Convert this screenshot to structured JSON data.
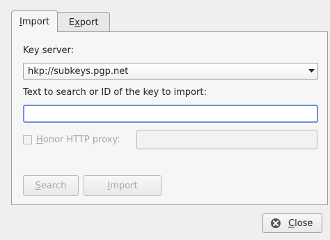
{
  "tabs": {
    "import": {
      "label_mnemonic": "I",
      "label_rest": "mport"
    },
    "export": {
      "label_prefix": "E",
      "label_mnemonic": "x",
      "label_rest": "port"
    }
  },
  "import_panel": {
    "key_server_label": "Key server:",
    "key_server_value": "hkp://subkeys.pgp.net",
    "search_label": "Text to search or ID of the key to import:",
    "search_value": "",
    "honor_proxy": {
      "checked": false,
      "mnemonic": "H",
      "rest": "onor HTTP proxy:"
    },
    "proxy_value": "",
    "search_button": {
      "mnemonic": "S",
      "rest": "earch"
    },
    "import_button": {
      "mnemonic": "I",
      "rest": "mport"
    }
  },
  "footer": {
    "close_button": {
      "mnemonic": "C",
      "rest": "lose"
    }
  },
  "colors": {
    "focus_border": "#6d93d4",
    "disabled_text": "#a6a6a6"
  },
  "icons": {
    "combo": "chevron-down-icon",
    "close": "close-icon"
  }
}
